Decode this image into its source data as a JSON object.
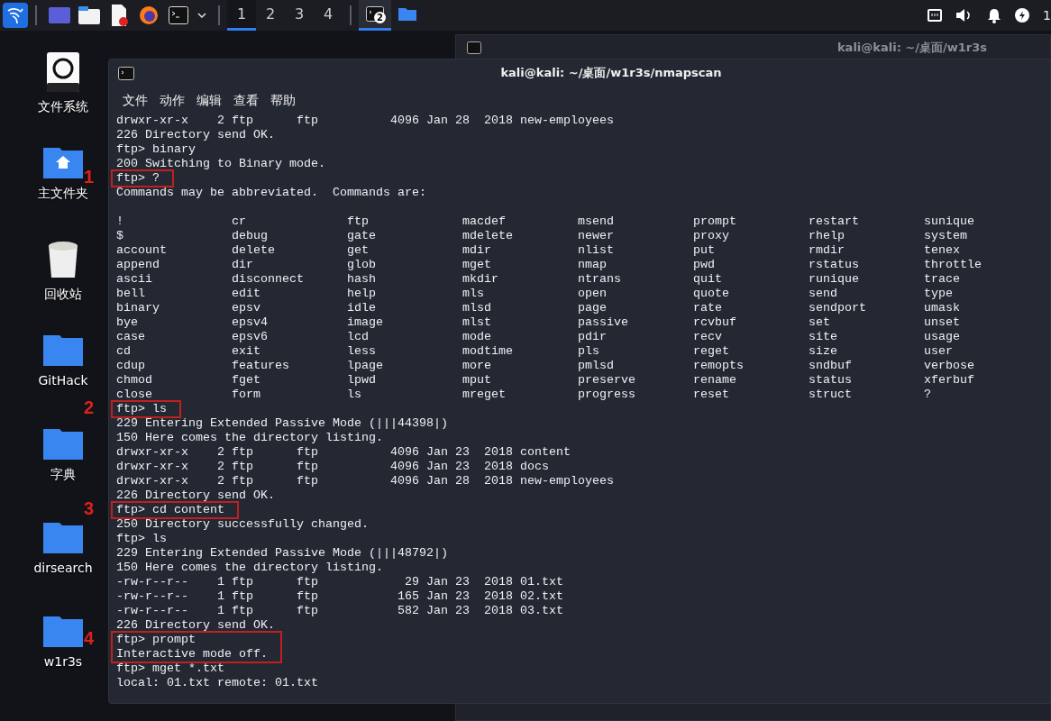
{
  "taskbar": {
    "workspaces": [
      {
        "label": "1",
        "selected": true
      },
      {
        "label": "2",
        "selected": false
      },
      {
        "label": "3",
        "selected": false
      },
      {
        "label": "4",
        "selected": false
      }
    ],
    "tasks": [
      {
        "kind": "terminal",
        "badge": "2",
        "active": true
      },
      {
        "kind": "folder",
        "active": false
      }
    ],
    "clock": "1"
  },
  "desktop_icons": [
    {
      "label": "文件系统",
      "kind": "drive"
    },
    {
      "label": "主文件夹",
      "kind": "home"
    },
    {
      "label": "回收站",
      "kind": "trash"
    },
    {
      "label": "GitHack",
      "kind": "folder"
    },
    {
      "label": "字典",
      "kind": "folder"
    },
    {
      "label": "dirsearch",
      "kind": "folder"
    },
    {
      "label": "w1r3s",
      "kind": "folder"
    }
  ],
  "back_window": {
    "title": "kali@kali: ~/桌面/w1r3s"
  },
  "terminal": {
    "title": "kali@kali: ~/桌面/w1r3s/nmapscan",
    "menu": [
      "文件",
      "动作",
      "编辑",
      "查看",
      "帮助"
    ],
    "blocks": [
      {
        "kind": "plain",
        "lines": [
          "drwxr-xr-x    2 ftp      ftp          4096 Jan 28  2018 new-employees",
          "226 Directory send OK.",
          "ftp> binary",
          "200 Switching to Binary mode."
        ]
      },
      {
        "kind": "annotated",
        "marker": "1",
        "lines": [
          "ftp> ?"
        ]
      },
      {
        "kind": "plain",
        "lines": [
          "Commands may be abbreviated.  Commands are:"
        ]
      },
      {
        "kind": "commands",
        "rows": [
          [
            "!",
            "cr",
            "ftp",
            "macdef",
            "msend",
            "prompt",
            "restart",
            "sunique"
          ],
          [
            "$",
            "debug",
            "gate",
            "mdelete",
            "newer",
            "proxy",
            "rhelp",
            "system"
          ],
          [
            "account",
            "delete",
            "get",
            "mdir",
            "nlist",
            "put",
            "rmdir",
            "tenex"
          ],
          [
            "append",
            "dir",
            "glob",
            "mget",
            "nmap",
            "pwd",
            "rstatus",
            "throttle"
          ],
          [
            "ascii",
            "disconnect",
            "hash",
            "mkdir",
            "ntrans",
            "quit",
            "runique",
            "trace"
          ],
          [
            "bell",
            "edit",
            "help",
            "mls",
            "open",
            "quote",
            "send",
            "type"
          ],
          [
            "binary",
            "epsv",
            "idle",
            "mlsd",
            "page",
            "rate",
            "sendport",
            "umask"
          ],
          [
            "bye",
            "epsv4",
            "image",
            "mlst",
            "passive",
            "rcvbuf",
            "set",
            "unset"
          ],
          [
            "case",
            "epsv6",
            "lcd",
            "mode",
            "pdir",
            "recv",
            "site",
            "usage"
          ],
          [
            "cd",
            "exit",
            "less",
            "modtime",
            "pls",
            "reget",
            "size",
            "user"
          ],
          [
            "cdup",
            "features",
            "lpage",
            "more",
            "pmlsd",
            "remopts",
            "sndbuf",
            "verbose"
          ],
          [
            "chmod",
            "fget",
            "lpwd",
            "mput",
            "preserve",
            "rename",
            "status",
            "xferbuf"
          ],
          [
            "close",
            "form",
            "ls",
            "mreget",
            "progress",
            "reset",
            "struct",
            "?"
          ]
        ]
      },
      {
        "kind": "annotated",
        "marker": "2",
        "lines": [
          "ftp> ls"
        ]
      },
      {
        "kind": "plain",
        "lines": [
          "229 Entering Extended Passive Mode (|||44398|)",
          "150 Here comes the directory listing.",
          "drwxr-xr-x    2 ftp      ftp          4096 Jan 23  2018 content",
          "drwxr-xr-x    2 ftp      ftp          4096 Jan 23  2018 docs",
          "drwxr-xr-x    2 ftp      ftp          4096 Jan 28  2018 new-employees",
          "226 Directory send OK."
        ]
      },
      {
        "kind": "annotated",
        "marker": "3",
        "lines": [
          "ftp> cd content"
        ]
      },
      {
        "kind": "plain",
        "lines": [
          "250 Directory successfully changed.",
          "ftp> ls",
          "229 Entering Extended Passive Mode (|||48792|)",
          "150 Here comes the directory listing.",
          "-rw-r--r--    1 ftp      ftp            29 Jan 23  2018 01.txt",
          "-rw-r--r--    1 ftp      ftp           165 Jan 23  2018 02.txt",
          "-rw-r--r--    1 ftp      ftp           582 Jan 23  2018 03.txt",
          "226 Directory send OK."
        ]
      },
      {
        "kind": "annotated",
        "marker": "4",
        "lines": [
          "ftp> prompt",
          "Interactive mode off."
        ]
      },
      {
        "kind": "plain",
        "lines": [
          "ftp> mget *.txt",
          "local: 01.txt remote: 01.txt"
        ]
      }
    ]
  }
}
